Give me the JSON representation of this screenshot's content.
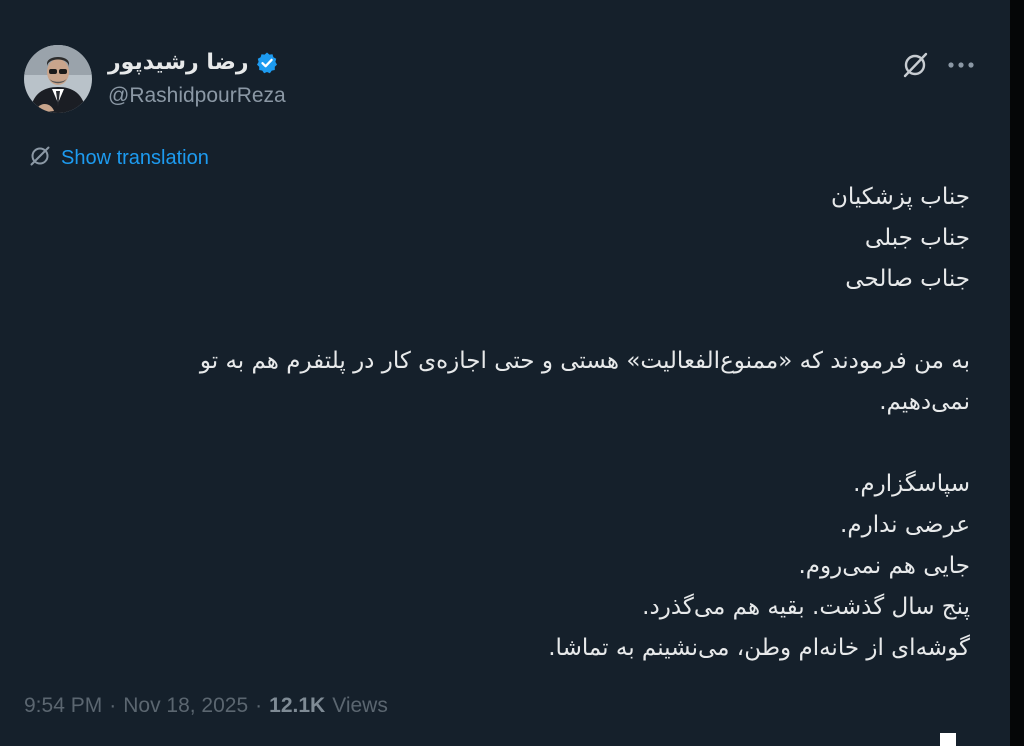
{
  "tweet": {
    "author": {
      "display_name": "رضا رشیدپور",
      "handle": "@RashidpourReza",
      "verified": true,
      "avatar_icon": "profile-photo"
    },
    "translation_label": "Show translation",
    "text_lines": [
      "جناب پزشکیان",
      "جناب جبلی",
      "جناب صالحی",
      "",
      "به من فرمودند که «ممنوع‌الفعالیت» هستی و حتی اجازه‌ی کار در پلتفرم هم به تو",
      "نمی‌دهیم.",
      "",
      "سپاسگزارم.",
      "عرضی ندارم.",
      "جایی هم نمی‌روم.",
      "پنج سال گذشت. بقیه هم می‌گذرد.",
      "گوشه‌ای از خانه‌ام وطن، می‌نشینم به تماشا."
    ],
    "meta": {
      "time": "9:54 PM",
      "separator": "·",
      "date": "Nov 18, 2025",
      "views_count": "12.1K",
      "views_label": "Views"
    }
  },
  "icons": {
    "verified": "verified-badge-icon",
    "grok": "grok-icon",
    "more": "more-options-icon",
    "translate": "translate-globe-icon"
  },
  "colors": {
    "background": "#15202b",
    "text": "#e7e9ea",
    "secondary_text": "#8b98a5",
    "link": "#1d9bf0",
    "verified": "#1d9bf0"
  }
}
